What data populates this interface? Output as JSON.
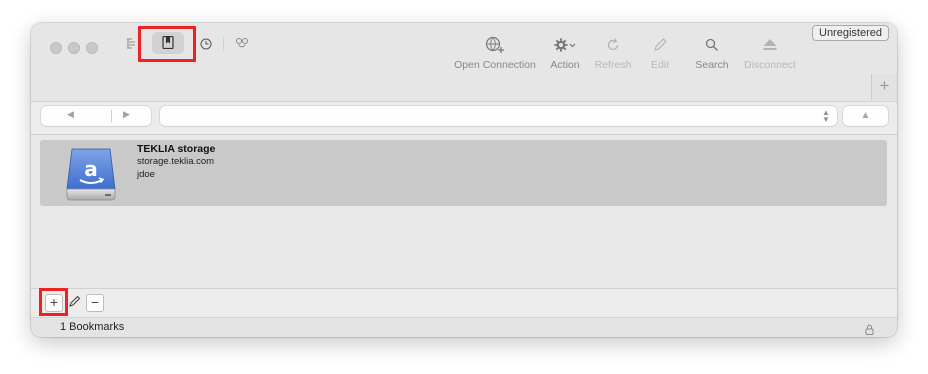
{
  "toolbar": {
    "tools": [
      {
        "id": "open_connection",
        "label": "Open Connection",
        "enabled": true
      },
      {
        "id": "action",
        "label": "Action",
        "enabled": true
      },
      {
        "id": "refresh",
        "label": "Refresh",
        "enabled": false
      },
      {
        "id": "edit",
        "label": "Edit",
        "enabled": false
      },
      {
        "id": "search",
        "label": "Search",
        "enabled": true
      },
      {
        "id": "disconnect",
        "label": "Disconnect",
        "enabled": false
      }
    ],
    "view_modes": [
      "browser-outline-icon",
      "bookmark-icon",
      "history-icon",
      "bonjour-icon"
    ],
    "selected_view": "bookmark-icon"
  },
  "badge": {
    "label": "Unregistered"
  },
  "new_tab": {
    "label": "+"
  },
  "navigation": {
    "back": "◀",
    "forward": "▶",
    "up": "▲"
  },
  "bookmarks": [
    {
      "title": "TEKLIA storage",
      "host": "storage.teklia.com",
      "user": "jdoe",
      "icon": "amazon-s3-disk-icon"
    }
  ],
  "bottom_buttons": {
    "add": "+",
    "remove": "−"
  },
  "status": {
    "text": "1 Bookmarks"
  },
  "highlight_color": "#ee2222"
}
